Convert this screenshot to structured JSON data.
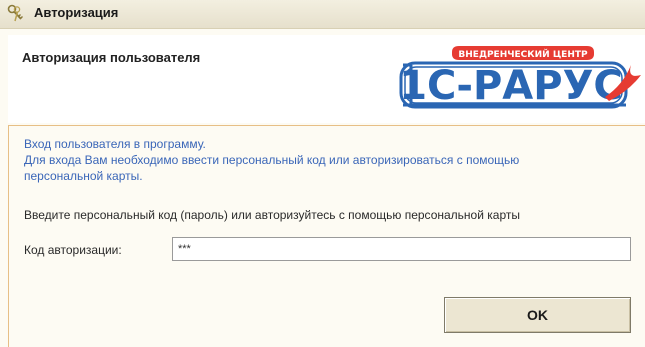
{
  "window": {
    "title": "Авторизация",
    "icon": "keys-icon"
  },
  "header": {
    "title": "Авторизация пользователя",
    "logo": {
      "badge_text": "ВНЕДРЕНЧЕСКИЙ ЦЕНТР",
      "main_text": "1С-РАРУС",
      "colors": {
        "blue": "#2a66b3",
        "red": "#e63b32"
      }
    }
  },
  "form": {
    "info_line1": "Вход пользователя в программу.",
    "info_line2": "Для входа Вам необходимо ввести персональный код или авторизироваться с помощью",
    "info_line3": "персональной карты.",
    "prompt": "Введите персональный код (пароль) или авторизуйтесь с помощью персональной карты",
    "code_label": "Код авторизации:",
    "code_value": "***"
  },
  "buttons": {
    "ok_label": "OK"
  },
  "colors": {
    "info_text": "#3a66b8",
    "divider": "#e7bf86",
    "window_bg": "#fdfbf3"
  }
}
